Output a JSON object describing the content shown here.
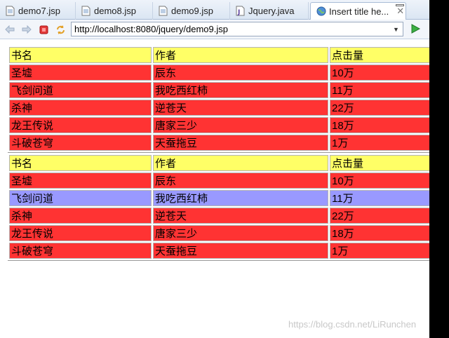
{
  "tabs": [
    {
      "label": "demo7.jsp",
      "icon": "jsp-file-icon",
      "active": false
    },
    {
      "label": "demo8.jsp",
      "icon": "jsp-file-icon",
      "active": false
    },
    {
      "label": "demo9.jsp",
      "icon": "jsp-file-icon",
      "active": false
    },
    {
      "label": "Jquery.java",
      "icon": "java-file-icon",
      "active": false
    },
    {
      "label": "Insert title he...",
      "icon": "globe-icon",
      "active": true
    }
  ],
  "toolbar": {
    "url": "http://localhost:8080/jquery/demo9.jsp"
  },
  "tables": [
    {
      "header": [
        "书名",
        "作者",
        "点击量"
      ],
      "rows": [
        [
          "圣墟",
          "辰东",
          "10万"
        ],
        [
          "飞剑问道",
          "我吃西红柿",
          "11万"
        ],
        [
          "杀神",
          "逆苍天",
          "22万"
        ],
        [
          "龙王传说",
          "唐家三少",
          "18万"
        ],
        [
          "斗破苍穹",
          "天蚕拖豆",
          "1万"
        ]
      ],
      "highlight_row": -1
    },
    {
      "header": [
        "书名",
        "作者",
        "点击量"
      ],
      "rows": [
        [
          "圣墟",
          "辰东",
          "10万"
        ],
        [
          "飞剑问道",
          "我吃西红柿",
          "11万"
        ],
        [
          "杀神",
          "逆苍天",
          "22万"
        ],
        [
          "龙王传说",
          "唐家三少",
          "18万"
        ],
        [
          "斗破苍穹",
          "天蚕拖豆",
          "1万"
        ]
      ],
      "highlight_row": 1
    }
  ],
  "colors": {
    "header_bg": "#ffff66",
    "row_bg": "#ff3333",
    "highlight_bg": "#9999ff"
  },
  "watermark": "https://blog.csdn.net/LiRunchen"
}
